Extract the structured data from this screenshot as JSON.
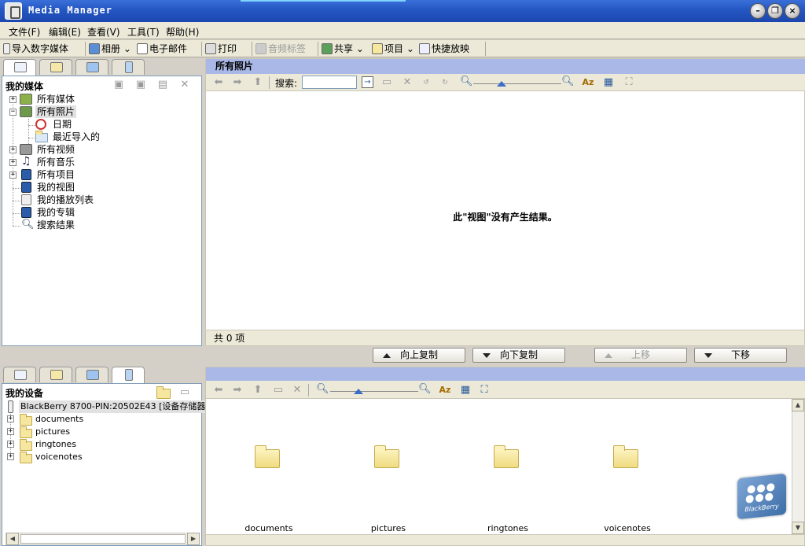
{
  "window": {
    "title": "Media Manager"
  },
  "menu": [
    "文件(F)",
    "编辑(E)",
    "查看(V)",
    "工具(T)",
    "帮助(H)"
  ],
  "toolbar": {
    "import": "导入数字媒体",
    "album": "相册",
    "email": "电子邮件",
    "print": "打印",
    "audio_tag": "音频标签",
    "share": "共享",
    "project": "项目",
    "slideshow": "快捷放映"
  },
  "media_tree": {
    "title": "我的媒体",
    "items": [
      "所有媒体",
      "所有照片",
      "日期",
      "最近导入的",
      "所有视频",
      "所有音乐",
      "所有项目",
      "我的视图",
      "我的播放列表",
      "我的专辑",
      "搜索结果"
    ]
  },
  "photos": {
    "header": "所有照片",
    "search_label": "搜索:",
    "search_value": "",
    "empty_message": "此\"视图\"没有产生结果。",
    "status": "共 0 项"
  },
  "transfer": {
    "copy_up": "向上复制",
    "copy_down": "向下复制",
    "move_up": "上移",
    "move_down": "下移"
  },
  "device_tree": {
    "title": "我的设备",
    "device": "BlackBerry 8700-PIN:20502E43 [设备存储器]",
    "folders": [
      "documents",
      "pictures",
      "ringtones",
      "voicenotes"
    ]
  },
  "device_view": {
    "folders": [
      "documents",
      "pictures",
      "ringtones",
      "voicenotes"
    ],
    "logo_text": "BlackBerry"
  }
}
